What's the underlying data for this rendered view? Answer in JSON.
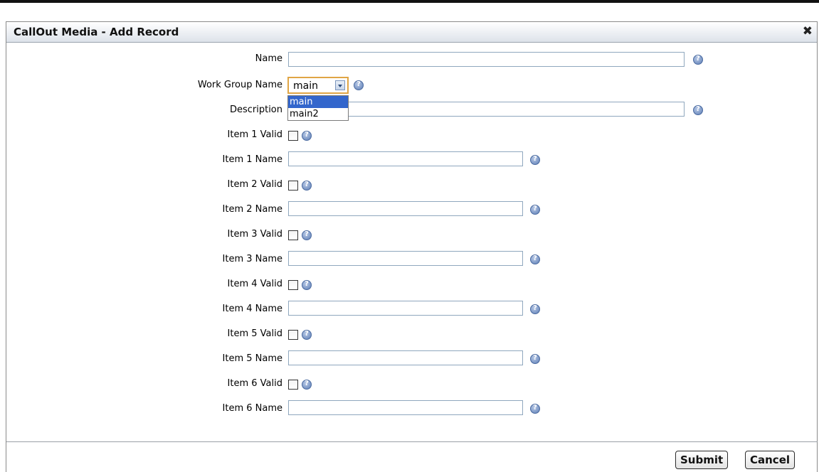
{
  "dialog": {
    "title": "CallOut Media - Add Record",
    "close_icon": "close-icon"
  },
  "form": {
    "name_label": "Name",
    "name_value": "",
    "workgroup_label": "Work Group Name",
    "workgroup_selected": "main",
    "workgroup_options": [
      "main",
      "main2"
    ],
    "description_label": "Description",
    "description_value": "",
    "items": [
      {
        "valid_label": "Item 1 Valid",
        "name_label": "Item 1 Name",
        "valid": false,
        "name_value": ""
      },
      {
        "valid_label": "Item 2 Valid",
        "name_label": "Item 2 Name",
        "valid": false,
        "name_value": ""
      },
      {
        "valid_label": "Item 3 Valid",
        "name_label": "Item 3 Name",
        "valid": false,
        "name_value": ""
      },
      {
        "valid_label": "Item 4 Valid",
        "name_label": "Item 4 Name",
        "valid": false,
        "name_value": ""
      },
      {
        "valid_label": "Item 5 Valid",
        "name_label": "Item 5 Name",
        "valid": false,
        "name_value": ""
      },
      {
        "valid_label": "Item 6 Valid",
        "name_label": "Item 6 Name",
        "valid": false,
        "name_value": ""
      }
    ]
  },
  "buttons": {
    "submit_label": "Submit",
    "cancel_label": "Cancel"
  },
  "colors": {
    "select_focus_border": "#e0a545",
    "option_highlight": "#3366cc",
    "help_icon": "#5c7db5"
  }
}
